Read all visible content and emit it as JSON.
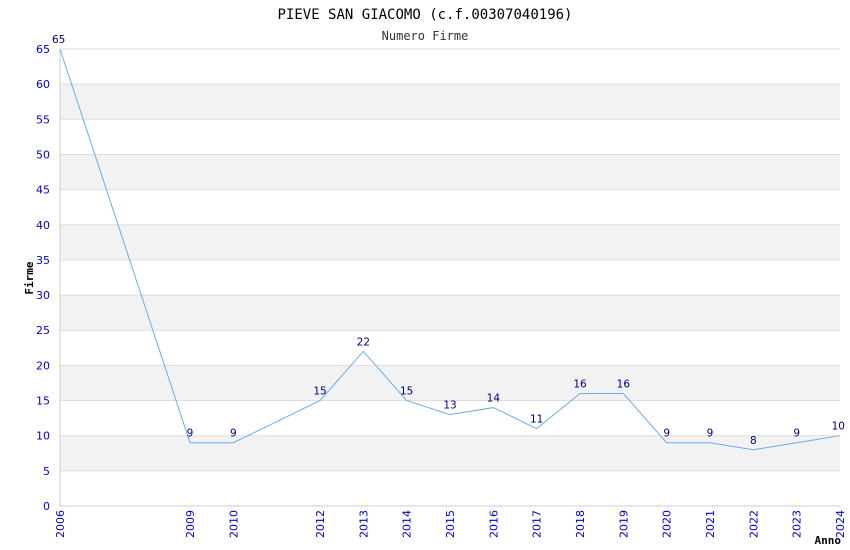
{
  "chart_data": {
    "type": "line",
    "title": "PIEVE SAN GIACOMO (c.f.00307040196)",
    "subtitle": "Numero Firme",
    "xlabel": "Anno",
    "ylabel": "Firme",
    "categories": [
      "2006",
      "2009",
      "2010",
      "2012",
      "2013",
      "2014",
      "2015",
      "2016",
      "2017",
      "2018",
      "2019",
      "2020",
      "2021",
      "2022",
      "2023",
      "2024"
    ],
    "series": [
      {
        "values": [
          65,
          9,
          9,
          15,
          22,
          15,
          13,
          14,
          11,
          16,
          16,
          9,
          9,
          8,
          9,
          10
        ]
      }
    ],
    "ylim": [
      0,
      65
    ],
    "yticks": [
      0,
      5,
      10,
      15,
      20,
      25,
      30,
      35,
      40,
      45,
      50,
      55,
      60,
      65
    ],
    "grid": true,
    "colors": {
      "line": "#6aaee8",
      "band": "#f2f2f2",
      "grid": "#dddddd",
      "tick": "#0000cc",
      "data_label": "#000080"
    }
  }
}
